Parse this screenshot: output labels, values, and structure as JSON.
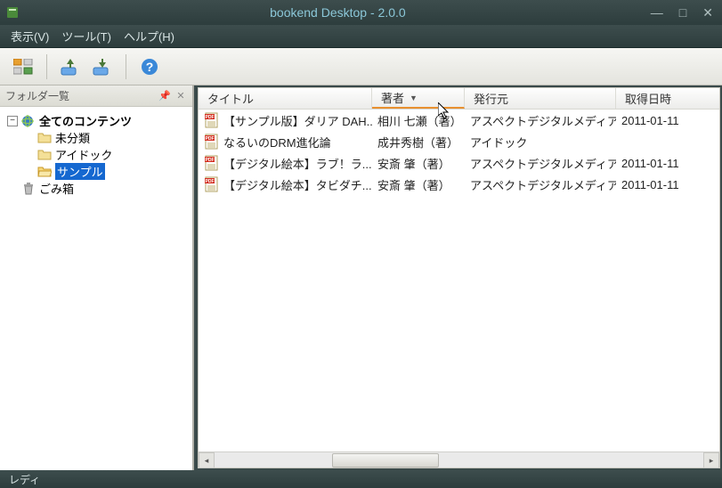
{
  "window": {
    "title": "bookend Desktop - 2.0.0"
  },
  "menu": {
    "view": "表示(V)",
    "tool": "ツール(T)",
    "help": "ヘルプ(H)"
  },
  "sidebar": {
    "title": "フォルダ一覧",
    "root": "全てのコンテンツ",
    "items": [
      {
        "label": "未分類"
      },
      {
        "label": "アイドック"
      },
      {
        "label": "サンプル"
      }
    ],
    "trash": "ごみ箱"
  },
  "columns": {
    "title": "タイトル",
    "author": "著者",
    "publisher": "発行元",
    "date": "取得日時"
  },
  "rows": [
    {
      "title": "【サンプル版】ダリア DAH...",
      "author": "相川 七瀬（著）",
      "publisher": "アスペクトデジタルメディア",
      "date": "2011-01-11"
    },
    {
      "title": "なるいのDRM進化論",
      "author": "成井秀樹（著）",
      "publisher": "アイドック",
      "date": ""
    },
    {
      "title": "【デジタル絵本】ラブ！ラ...",
      "author": "安斎 肇（著）",
      "publisher": "アスペクトデジタルメディア",
      "date": "2011-01-11"
    },
    {
      "title": "【デジタル絵本】タビダチ...",
      "author": "安斎 肇（著）",
      "publisher": "アスペクトデジタルメディア",
      "date": "2011-01-11"
    }
  ],
  "status": "レディ"
}
